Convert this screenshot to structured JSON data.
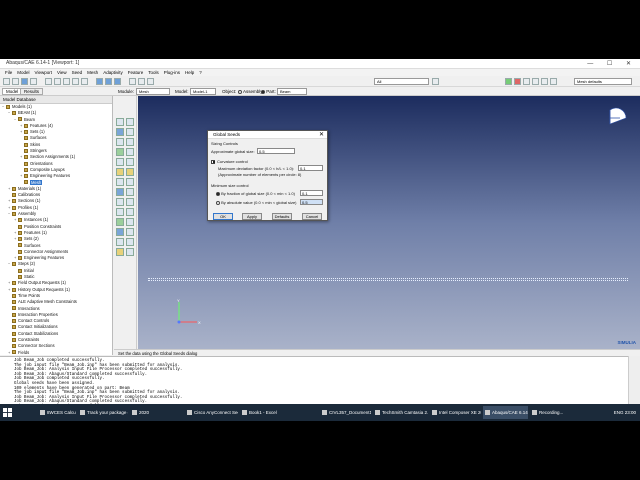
{
  "window": {
    "title": "Abaqus/CAE 6.14-1 [Viewport: 1]"
  },
  "menu": [
    "File",
    "Model",
    "Viewport",
    "View",
    "Seed",
    "Mesh",
    "Adaptivity",
    "Feature",
    "Tools",
    "Plug-ins",
    "Help",
    "?"
  ],
  "toolbar": {
    "field_value": "All",
    "mesh_defaults_label": "Mesh defaults"
  },
  "tabs": [
    "Model",
    "Results"
  ],
  "context": {
    "module_label": "Module:",
    "module_value": "Mesh",
    "model_label": "Model:",
    "model_value": "Model-1",
    "object_label": "Object:",
    "assembly_label": "Assembly",
    "part_label": "Part:",
    "part_value": "Beam"
  },
  "tree": {
    "header": "Model Database",
    "items": [
      {
        "label": "Models (1)",
        "indent": 0,
        "exp": "−"
      },
      {
        "label": "BEAM (1)",
        "indent": 1,
        "exp": "−"
      },
      {
        "label": "Beam",
        "indent": 2,
        "exp": "−"
      },
      {
        "label": "Features (4)",
        "indent": 3,
        "exp": "+"
      },
      {
        "label": "Sets (1)",
        "indent": 3,
        "exp": "+"
      },
      {
        "label": "Surfaces",
        "indent": 3,
        "exp": ""
      },
      {
        "label": "Skins",
        "indent": 3,
        "exp": ""
      },
      {
        "label": "Stringers",
        "indent": 3,
        "exp": ""
      },
      {
        "label": "Section Assignments (1)",
        "indent": 3,
        "exp": "+"
      },
      {
        "label": "Orientations",
        "indent": 3,
        "exp": ""
      },
      {
        "label": "Composite Layups",
        "indent": 3,
        "exp": ""
      },
      {
        "label": "Engineering Features",
        "indent": 3,
        "exp": "+"
      },
      {
        "label": "Mesh",
        "indent": 3,
        "exp": "",
        "selected": true
      },
      {
        "label": "Materials (1)",
        "indent": 1,
        "exp": "+"
      },
      {
        "label": "Calibrations",
        "indent": 1,
        "exp": ""
      },
      {
        "label": "Sections (1)",
        "indent": 1,
        "exp": "+"
      },
      {
        "label": "Profiles (1)",
        "indent": 1,
        "exp": "+"
      },
      {
        "label": "Assembly",
        "indent": 1,
        "exp": "−"
      },
      {
        "label": "Instances (1)",
        "indent": 2,
        "exp": "+"
      },
      {
        "label": "Position Constraints",
        "indent": 2,
        "exp": ""
      },
      {
        "label": "Features (1)",
        "indent": 2,
        "exp": "+"
      },
      {
        "label": "Sets (2)",
        "indent": 2,
        "exp": "+"
      },
      {
        "label": "Surfaces",
        "indent": 2,
        "exp": ""
      },
      {
        "label": "Connector Assignments",
        "indent": 2,
        "exp": ""
      },
      {
        "label": "Engineering Features",
        "indent": 2,
        "exp": "+"
      },
      {
        "label": "Steps (2)",
        "indent": 1,
        "exp": "−"
      },
      {
        "label": "Initial",
        "indent": 2,
        "exp": ""
      },
      {
        "label": "Static",
        "indent": 2,
        "exp": ""
      },
      {
        "label": "Field Output Requests (1)",
        "indent": 1,
        "exp": "+"
      },
      {
        "label": "History Output Requests (1)",
        "indent": 1,
        "exp": "+"
      },
      {
        "label": "Time Points",
        "indent": 1,
        "exp": ""
      },
      {
        "label": "ALE Adaptive Mesh Constraints",
        "indent": 1,
        "exp": ""
      },
      {
        "label": "Interactions",
        "indent": 1,
        "exp": ""
      },
      {
        "label": "Interaction Properties",
        "indent": 1,
        "exp": ""
      },
      {
        "label": "Contact Controls",
        "indent": 1,
        "exp": ""
      },
      {
        "label": "Contact Initializations",
        "indent": 1,
        "exp": ""
      },
      {
        "label": "Contact Stabilizations",
        "indent": 1,
        "exp": ""
      },
      {
        "label": "Constraints",
        "indent": 1,
        "exp": ""
      },
      {
        "label": "Connector Sections",
        "indent": 1,
        "exp": ""
      },
      {
        "label": "Fields",
        "indent": 1,
        "exp": "+"
      },
      {
        "label": "Amplitudes",
        "indent": 1,
        "exp": ""
      }
    ]
  },
  "dialog": {
    "title": "Global Seeds",
    "section": "Sizing Controls",
    "approx_size_label": "Approximate global size:",
    "approx_size_value": "0.5",
    "curvature_label": "Curvature control",
    "max_dev_label": "Maximum deviation factor (0.0 < h/L < 1.0):",
    "max_dev_value": "0.1",
    "approx_elems_label": "(Approximate number of elements per circle: 8)",
    "min_size_label": "Minimum size control",
    "by_fraction_label": "By fraction of global size  (0.0 < min < 1.0)",
    "by_fraction_value": "0.1",
    "by_absolute_label": "By absolute value  (0.0 < min < global size)",
    "by_absolute_value": "0.5",
    "ok": "OK",
    "apply": "Apply",
    "defaults": "Defaults",
    "cancel": "Cancel"
  },
  "viewport": {
    "logo": "SIMULIA"
  },
  "prompt": "Set the data using the Global Seeds dialog",
  "messages": [
    "Job Beam_Job completed successfully.",
    "The job input file \"Beam_Job.inp\" has been submitted for analysis.",
    "Job Beam_Job: Analysis Input File Processor completed successfully.",
    "Job Beam_Job: Abaqus/Standard completed successfully.",
    "Job Beam_Job completed successfully.",
    "Global seeds have been assigned.",
    "100 elements have been generated on part: Beam",
    "The job input file \"Beam_Job.inp\" has been submitted for analysis.",
    "Job Beam_Job: Analysis Input File Processor completed successfully.",
    "Job Beam_Job: Abaqus/Standard completed successfully.",
    "Job Beam_Job completed successfully."
  ],
  "taskbar": {
    "items": [
      "8WCES Calculation of...",
      "Track your package or...",
      "2020",
      "Cisco AnyConnect Sec...",
      "Book1 - Excel",
      "CIVL357_Document10...",
      "TechSmith Camtasia 2...",
      "Intel Composer XE 201...",
      "Abaqus/CAE 6.14-1 [V...",
      "Recording..."
    ],
    "tray": "ENG   23:00"
  }
}
